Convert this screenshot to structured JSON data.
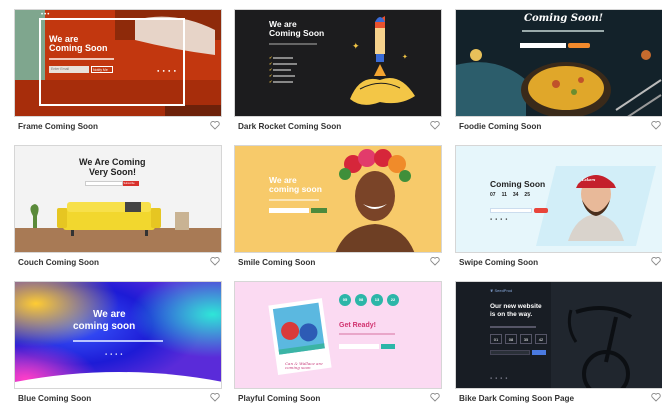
{
  "templates": [
    {
      "name": "Frame Coming Soon",
      "headline1": "We are",
      "headline2": "Coming Soon",
      "input_placeholder": "Enter Email",
      "button": "Notify Me"
    },
    {
      "name": "Dark Rocket Coming Soon",
      "headline1": "We are",
      "headline2": "Coming Soon"
    },
    {
      "name": "Foodie Coming Soon",
      "headline1": "Coming Soon!"
    },
    {
      "name": "Couch Coming Soon",
      "headline1": "We Are Coming",
      "headline2": "Very Soon!",
      "button": "Subscribe"
    },
    {
      "name": "Smile Coming Soon",
      "headline1": "We are",
      "headline2": "coming soon"
    },
    {
      "name": "Swipe Coming Soon",
      "headline1": "Coming Soon",
      "countdown": [
        "07",
        "11",
        "34",
        "25"
      ],
      "cap_text": "Lakers"
    },
    {
      "name": "Blue Coming Soon",
      "headline1": "We are",
      "headline2": "coming soon"
    },
    {
      "name": "Playful Coming Soon",
      "headline1": "Get Ready!",
      "countdown": [
        "05",
        "08",
        "13",
        "22"
      ],
      "note": "Can & Wallace are coming soon"
    },
    {
      "name": "Bike Dark Coming Soon Page",
      "brand": "SeedProd",
      "headline1": "Our new website",
      "headline2": "is on the way.",
      "countdown": [
        "01",
        "08",
        "35",
        "42"
      ]
    }
  ],
  "colors": {
    "caption": "#333333",
    "border": "#d6d6d6",
    "heart": "#8a8a8a"
  }
}
